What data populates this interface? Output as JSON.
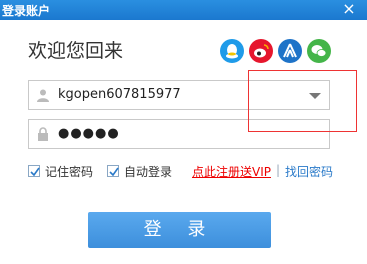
{
  "window": {
    "title": "登录账户",
    "close_glyph": "×"
  },
  "welcome": "欢迎您回来",
  "social_icons": [
    "qq-icon",
    "weibo-icon",
    "renren-icon",
    "wechat-icon"
  ],
  "colors": {
    "accent": "#2a8fe0",
    "qq": "#1f9be9",
    "weibo": "#e6162d",
    "renren": "#1e73c8",
    "wechat": "#44b549",
    "link_red": "#e00000",
    "link_blue": "#2a7ac9"
  },
  "account": {
    "username": "kgopen607815977",
    "password_mask": "●●●●●"
  },
  "options": {
    "remember_password": "记住密码",
    "auto_login": "自动登录",
    "remember_checked": true,
    "auto_checked": true
  },
  "links": {
    "register": "点此注册送VIP",
    "separator": "|",
    "recover": "找回密码"
  },
  "login_button": "登 录"
}
